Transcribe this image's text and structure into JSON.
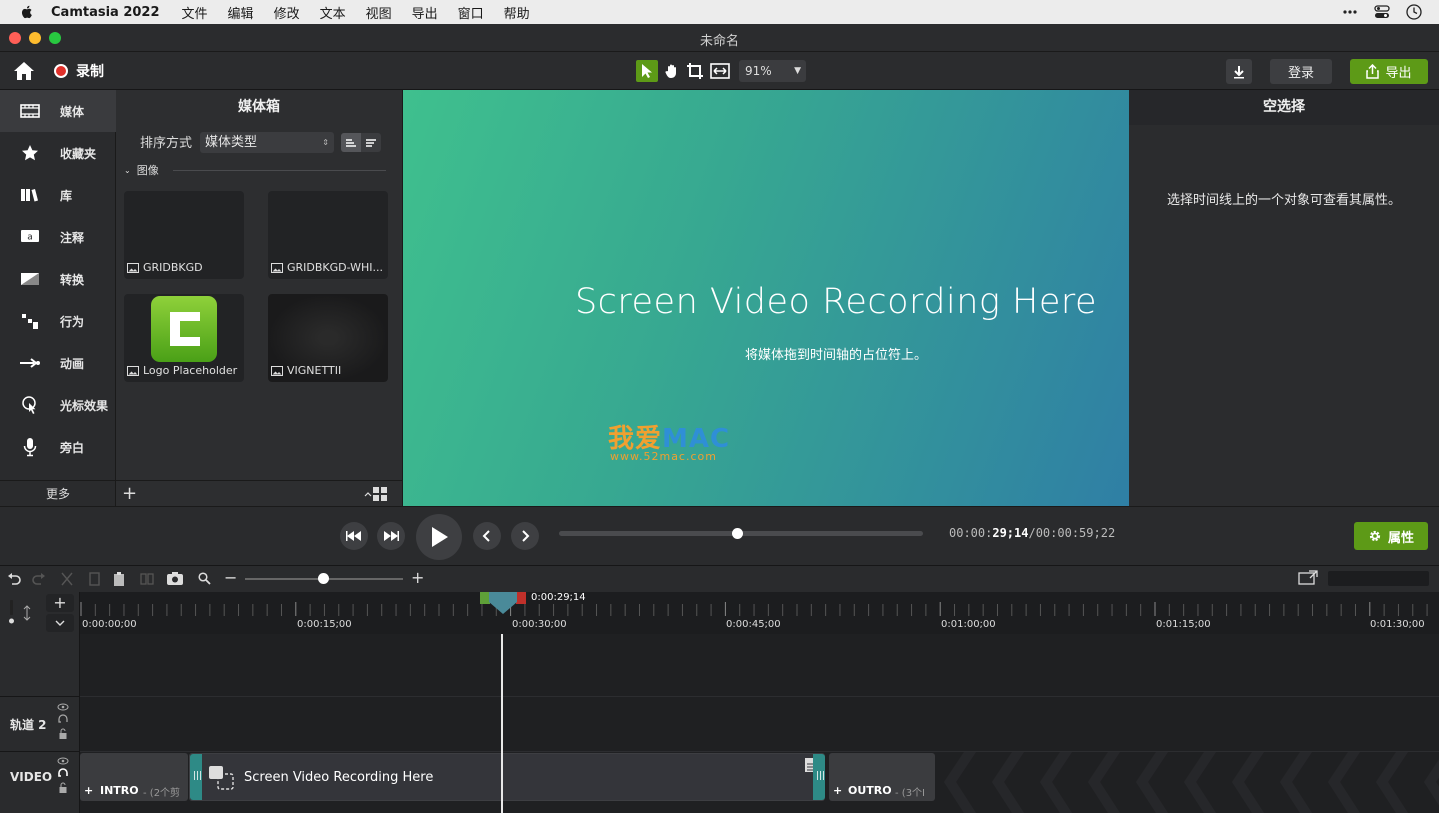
{
  "menubar": {
    "app_name": "Camtasia 2022",
    "items": [
      "文件",
      "编辑",
      "修改",
      "文本",
      "视图",
      "导出",
      "窗口",
      "帮助"
    ]
  },
  "window": {
    "title": "未命名"
  },
  "toolbar": {
    "record_label": "录制",
    "zoom_value": "91%",
    "login_label": "登录",
    "export_label": "导出",
    "accent_color": "#5d9a17"
  },
  "nav": {
    "items": [
      {
        "label": "媒体",
        "icon": "film-icon"
      },
      {
        "label": "收藏夹",
        "icon": "star-icon"
      },
      {
        "label": "库",
        "icon": "library-icon"
      },
      {
        "label": "注释",
        "icon": "annotation-icon"
      },
      {
        "label": "转换",
        "icon": "transition-icon"
      },
      {
        "label": "行为",
        "icon": "behavior-icon"
      },
      {
        "label": "动画",
        "icon": "animation-icon"
      },
      {
        "label": "光标效果",
        "icon": "cursor-effect-icon"
      },
      {
        "label": "旁白",
        "icon": "microphone-icon"
      }
    ],
    "more_label": "更多"
  },
  "media_bin": {
    "title": "媒体箱",
    "sort_label": "排序方式",
    "sort_value": "媒体类型",
    "section_label": "图像",
    "items": [
      {
        "name": "GRIDBKGD"
      },
      {
        "name": "GRIDBKGD-WHI..."
      },
      {
        "name": "Logo Placeholder"
      },
      {
        "name": "VIGNETTII"
      }
    ]
  },
  "canvas": {
    "title": "Screen Video Recording Here",
    "subtitle": "将媒体拖到时间轴的占位符上。",
    "watermark_cn": "我爱",
    "watermark_mac": "MAC",
    "watermark_url": "www.52mac.com"
  },
  "properties": {
    "title": "空选择",
    "message": "选择时间线上的一个对象可查看其属性。"
  },
  "playback": {
    "time_prefix": "00:00:",
    "time_current": "29;14",
    "time_total": "/00:00:59;22",
    "position_fraction": 0.49,
    "properties_label": "属性"
  },
  "timeline": {
    "playhead_label": "0:00:29;14",
    "ruler_labels": [
      "0:00:00;00",
      "0:00:15;00",
      "0:00:30;00",
      "0:00:45;00",
      "0:01:00;00",
      "0:01:15;00",
      "0:01:30;00"
    ],
    "tracks": [
      {
        "label": "轨道 2"
      },
      {
        "label": "VIDEO"
      }
    ],
    "clips": {
      "intro_label": "INTRO",
      "intro_count": "- (2个剪",
      "main_label": "Screen Video Recording Here",
      "outro_label": "OUTRO",
      "outro_count": "- (3个I"
    }
  }
}
